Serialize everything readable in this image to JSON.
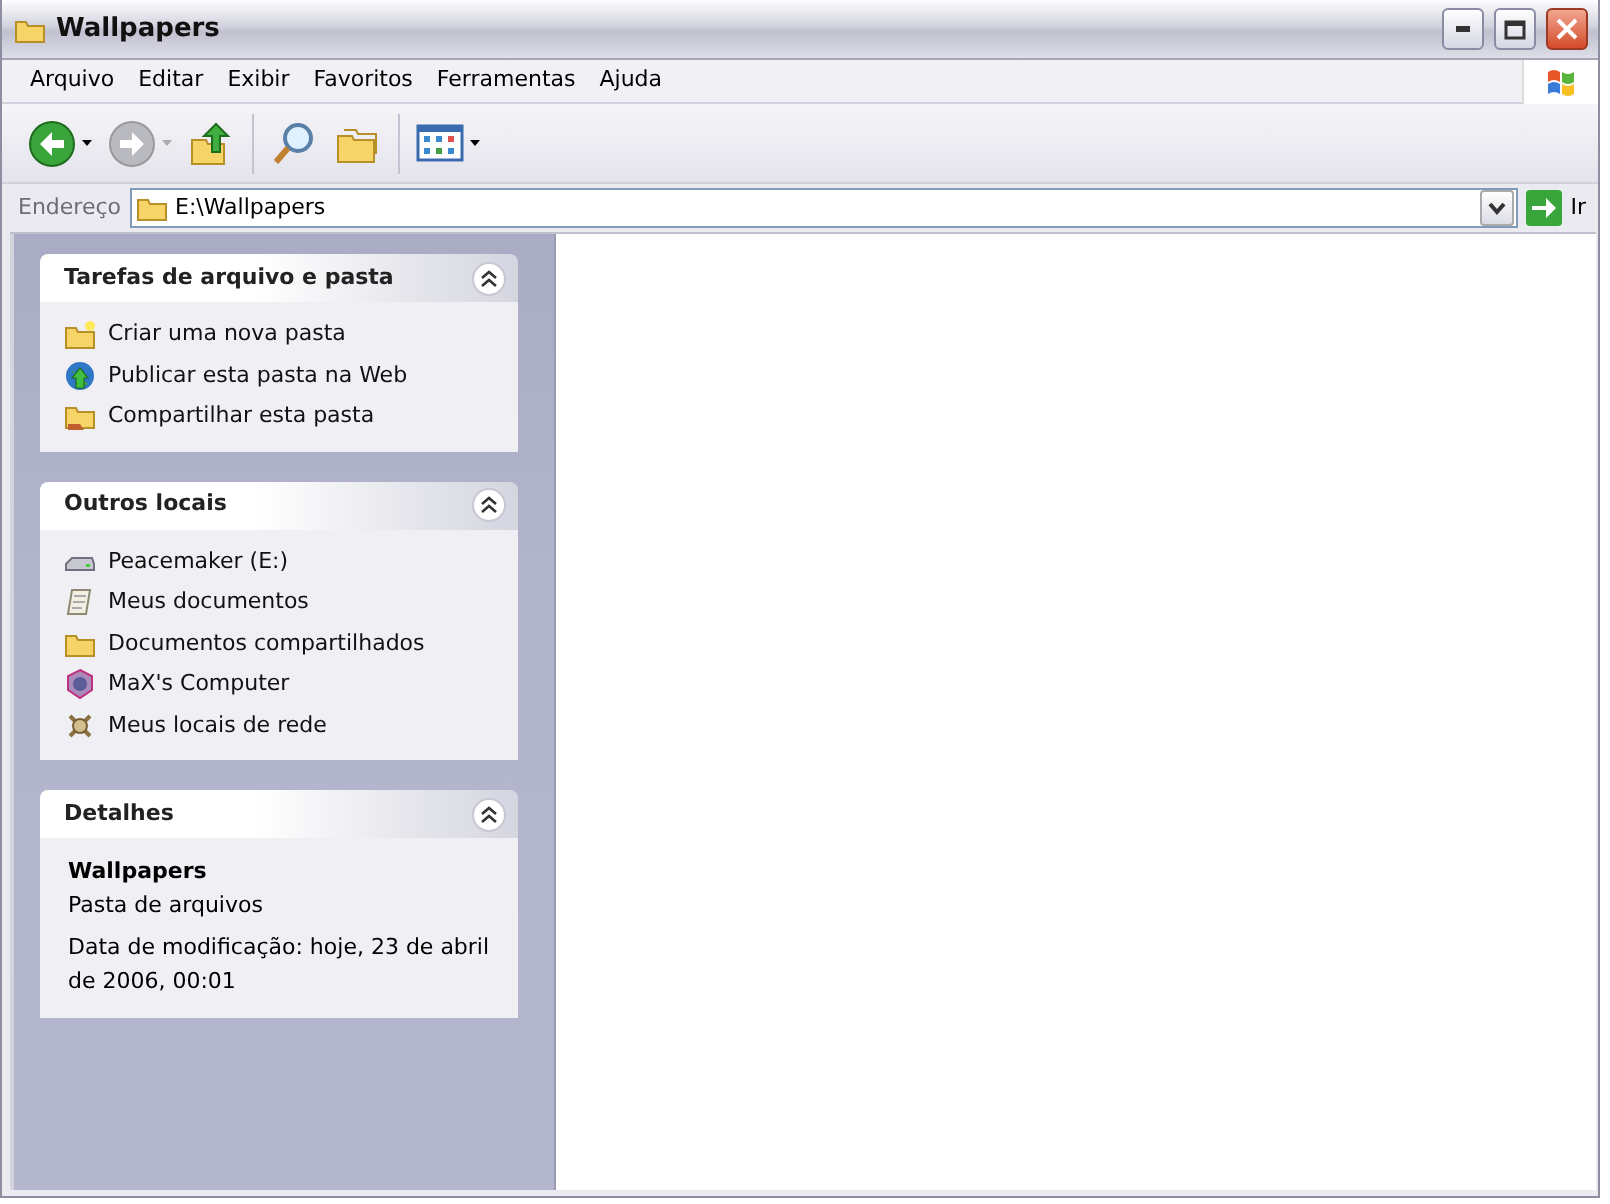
{
  "window": {
    "title": "Wallpapers"
  },
  "menu": [
    "Arquivo",
    "Editar",
    "Exibir",
    "Favoritos",
    "Ferramentas",
    "Ajuda"
  ],
  "toolbar": [
    {
      "kind": "back",
      "disabled": false
    },
    {
      "kind": "forward",
      "disabled": true
    },
    {
      "kind": "up"
    },
    {
      "kind": "search"
    },
    {
      "kind": "folders"
    },
    {
      "kind": "views"
    }
  ],
  "address": {
    "label": "Endereço",
    "value": "E:\\Wallpapers",
    "go": "Ir"
  },
  "panels": [
    {
      "kind": "links",
      "title": "Tarefas de arquivo e pasta",
      "expanded": true,
      "items": [
        {
          "kind": "new-folder",
          "label": "Criar uma nova pasta"
        },
        {
          "kind": "globe",
          "label": "Publicar esta pasta na Web"
        },
        {
          "kind": "share",
          "label": "Compartilhar esta pasta"
        }
      ]
    },
    {
      "kind": "links",
      "title": "Outros locais",
      "expanded": true,
      "items": [
        {
          "kind": "drive",
          "label": "Peacemaker (E:)"
        },
        {
          "kind": "documents",
          "label": "Meus documentos"
        },
        {
          "kind": "folder",
          "label": "Documentos compartilhados"
        },
        {
          "kind": "computer",
          "label": "MaX's Computer"
        },
        {
          "kind": "network",
          "label": "Meus locais de rede"
        }
      ]
    },
    {
      "kind": "details",
      "title": "Detalhes",
      "expanded": true,
      "name": "Wallpapers",
      "type": "Pasta de arquivos",
      "modified": "Data de modificação: hoje, 23 de abril de 2006, 00:01"
    }
  ]
}
